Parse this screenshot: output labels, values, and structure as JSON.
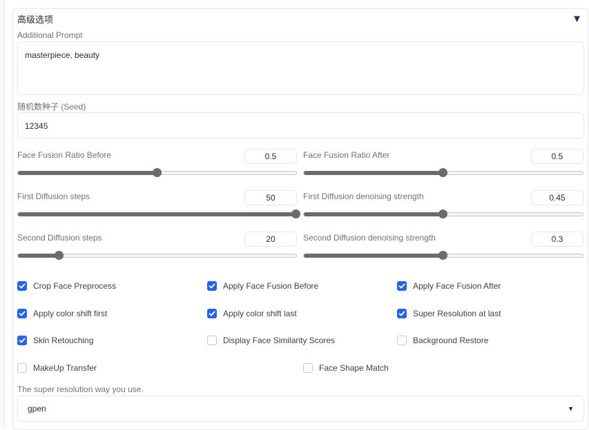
{
  "section": {
    "title": "高级选项",
    "toggle_icon": "▼"
  },
  "prompt": {
    "label": "Additional Prompt",
    "value": "masterpiece, beauty"
  },
  "seed": {
    "label": "随机数种子 (Seed)",
    "value": "12345"
  },
  "sliders": [
    {
      "label": "Face Fusion Ratio Before",
      "value": "0.5",
      "fraction": 0.5
    },
    {
      "label": "Face Fusion Ratio After",
      "value": "0.5",
      "fraction": 0.5
    },
    {
      "label": "First Diffusion steps",
      "value": "50",
      "fraction": 1.0
    },
    {
      "label": "First Diffusion denoising strength",
      "value": "0.45",
      "fraction": 0.5
    },
    {
      "label": "Second Diffusion steps",
      "value": "20",
      "fraction": 0.15
    },
    {
      "label": "Second Diffusion denoising strength",
      "value": "0.3",
      "fraction": 0.5
    }
  ],
  "checkboxes": [
    {
      "label": "Crop Face Preprocess",
      "checked": true
    },
    {
      "label": "Apply Face Fusion Before",
      "checked": true
    },
    {
      "label": "Apply Face Fusion After",
      "checked": true
    },
    {
      "label": "Apply color shift first",
      "checked": true
    },
    {
      "label": "Apply color shift last",
      "checked": true
    },
    {
      "label": "Super Resolution at last",
      "checked": true
    },
    {
      "label": "Skin Retouching",
      "checked": true
    },
    {
      "label": "Display Face Similarity Scores",
      "checked": false
    },
    {
      "label": "Background Restore",
      "checked": false
    },
    {
      "label": "MakeUp Transfer",
      "checked": false
    },
    {
      "label": "Face Shape Match",
      "checked": false
    }
  ],
  "super_resolution": {
    "label": "The super resolution way you use.",
    "value": "gpen",
    "caret_icon": "▼"
  },
  "colors": {
    "accent": "#2563eb",
    "slider": "#6b6b6b",
    "border": "#e5e7eb"
  }
}
